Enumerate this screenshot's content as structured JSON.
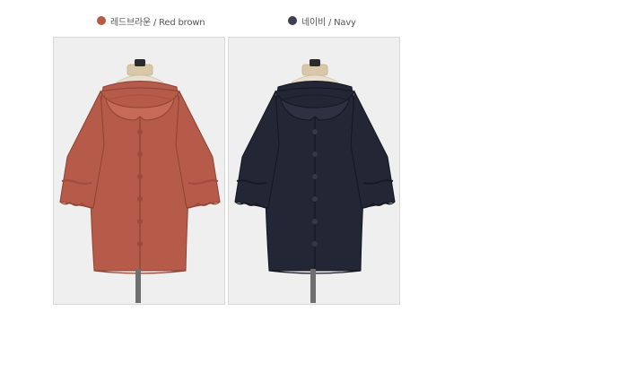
{
  "colors": [
    {
      "label": "레드브라운 / Red brown",
      "swatch_color": "#b45a47",
      "garment_color": "#b65a49",
      "shade_color": "#8e4334"
    },
    {
      "label": "네이비 / Navy",
      "swatch_color": "#3b3e55",
      "garment_color": "#232634",
      "shade_color": "#141620"
    }
  ],
  "images": [
    {
      "name": "red-brown-blouse-photo",
      "garment_icon": "blouse-icon"
    },
    {
      "name": "navy-blouse-photo",
      "garment_icon": "blouse-icon"
    }
  ]
}
